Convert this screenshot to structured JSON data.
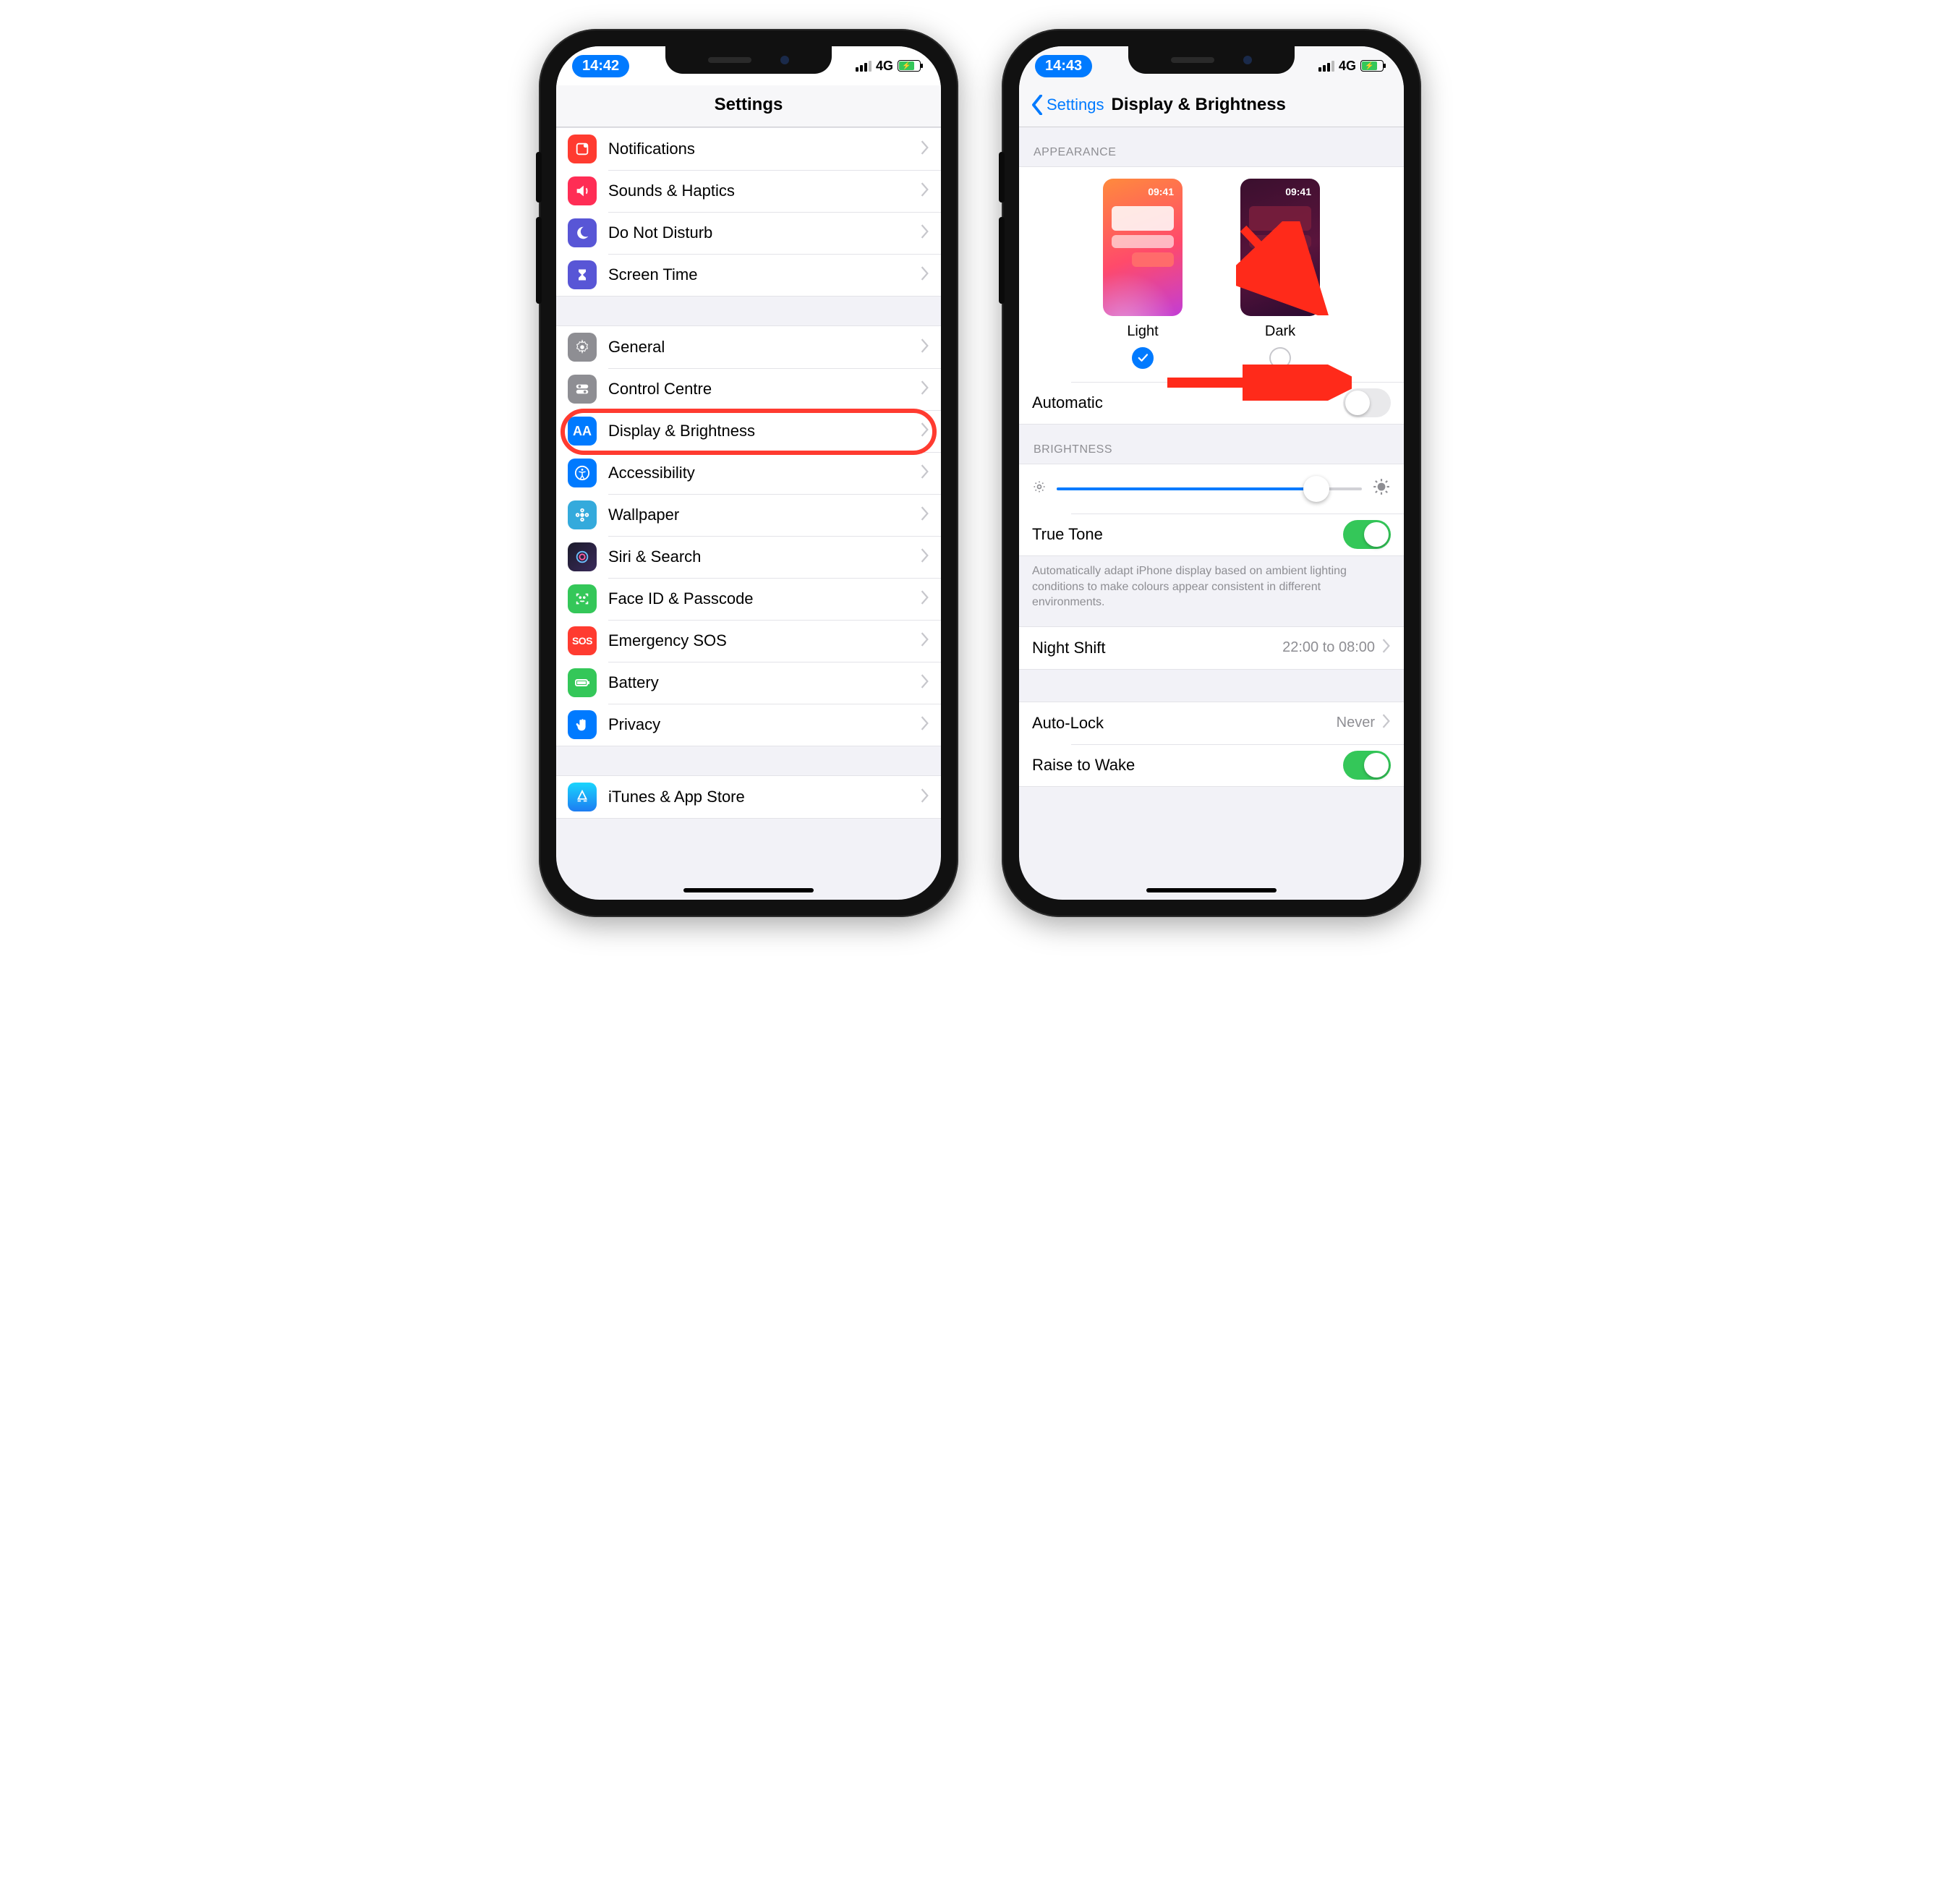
{
  "phone1": {
    "status": {
      "time": "14:42",
      "network": "4G"
    },
    "nav": {
      "title": "Settings"
    },
    "rows": [
      {
        "id": "notifications",
        "label": "Notifications"
      },
      {
        "id": "sounds",
        "label": "Sounds & Haptics"
      },
      {
        "id": "dnd",
        "label": "Do Not Disturb"
      },
      {
        "id": "screentime",
        "label": "Screen Time"
      },
      {
        "id": "general",
        "label": "General"
      },
      {
        "id": "controlcentre",
        "label": "Control Centre"
      },
      {
        "id": "display",
        "label": "Display & Brightness"
      },
      {
        "id": "accessibility",
        "label": "Accessibility"
      },
      {
        "id": "wallpaper",
        "label": "Wallpaper"
      },
      {
        "id": "siri",
        "label": "Siri & Search"
      },
      {
        "id": "faceid",
        "label": "Face ID & Passcode"
      },
      {
        "id": "sos",
        "label": "Emergency SOS"
      },
      {
        "id": "battery",
        "label": "Battery"
      },
      {
        "id": "privacy",
        "label": "Privacy"
      },
      {
        "id": "itunes",
        "label": "iTunes & App Store"
      }
    ]
  },
  "phone2": {
    "status": {
      "time": "14:43",
      "network": "4G"
    },
    "nav": {
      "back": "Settings",
      "title": "Display & Brightness"
    },
    "sections": {
      "appearance_header": "APPEARANCE",
      "light_label": "Light",
      "dark_label": "Dark",
      "preview_time": "09:41",
      "automatic_label": "Automatic",
      "brightness_header": "BRIGHTNESS",
      "truetone_label": "True Tone",
      "truetone_desc": "Automatically adapt iPhone display based on ambient lighting conditions to make colours appear consistent in different environments.",
      "nightshift_label": "Night Shift",
      "nightshift_value": "22:00 to 08:00",
      "autolock_label": "Auto-Lock",
      "autolock_value": "Never",
      "raise_label": "Raise to Wake"
    }
  }
}
